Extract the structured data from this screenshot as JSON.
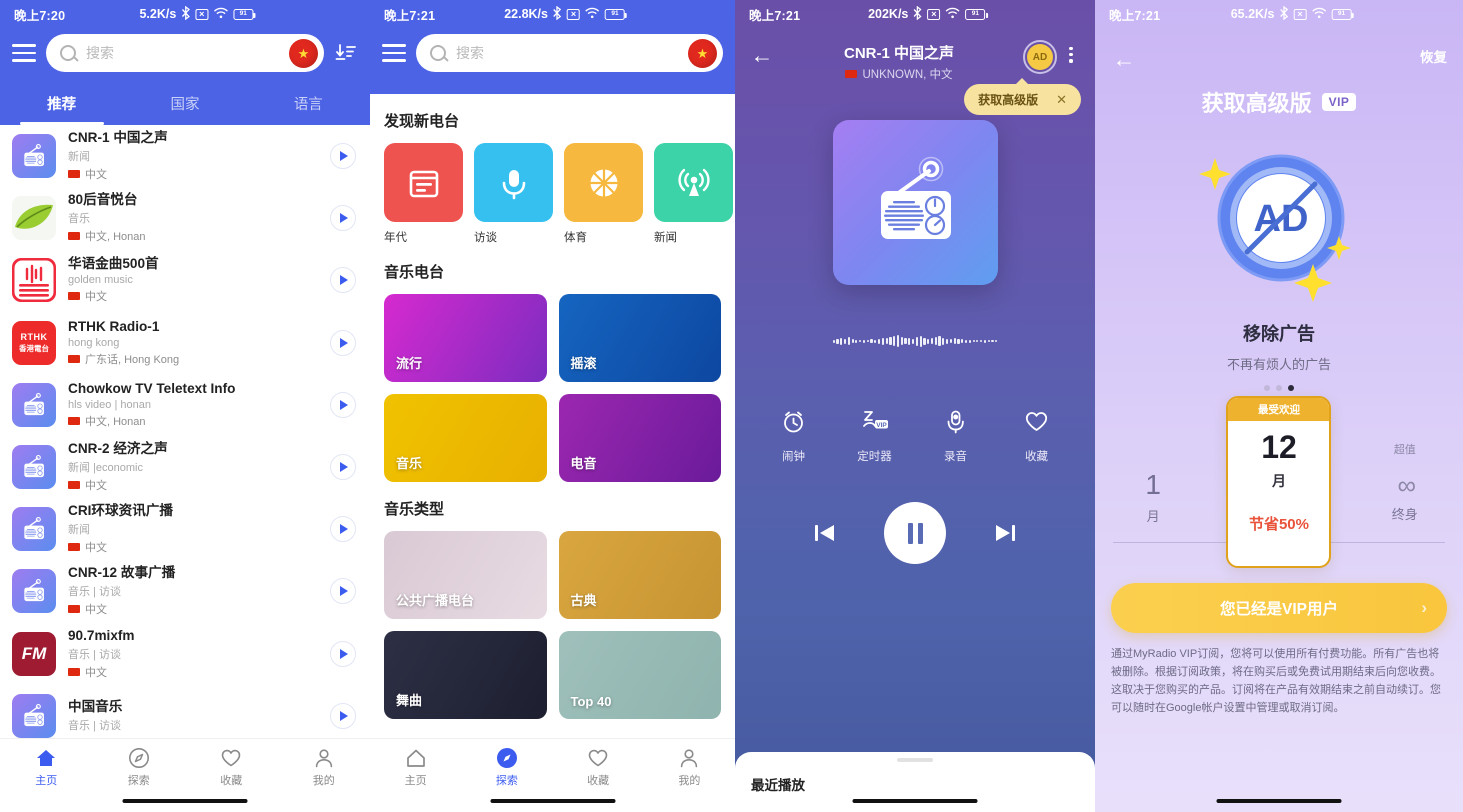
{
  "app": {
    "accent": "#4d63e6",
    "vip_gold": "#f5c944"
  },
  "panel1": {
    "status": {
      "time": "晚上7:20",
      "speed": "5.2K/s",
      "battery": "91"
    },
    "search": {
      "placeholder": "搜索",
      "value": ""
    },
    "menu_icon": "hamburger-icon",
    "flag_icon": "china-flag-icon",
    "sort_icon": "sort-download-icon",
    "tabs": [
      {
        "label": "推荐",
        "active": true
      },
      {
        "label": "国家",
        "active": false
      },
      {
        "label": "语言",
        "active": false
      }
    ],
    "stations": [
      {
        "name": "CNR-1 中国之声",
        "genre": "新闻",
        "lang": "中文",
        "logo": "radio"
      },
      {
        "name": "80后音悦台",
        "genre": "音乐",
        "lang": "中文, Honan",
        "logo": "leaf"
      },
      {
        "name": "华语金曲500首",
        "genre": "golden music",
        "lang": "中文",
        "logo": "redwave"
      },
      {
        "name": "RTHK Radio-1",
        "genre": "hong kong",
        "lang": "广东话, Hong Kong",
        "logo": "rthk"
      },
      {
        "name": "Chowkow TV Teletext Info",
        "genre": "hls video | honan",
        "lang": "中文, Honan",
        "logo": "radio"
      },
      {
        "name": "CNR-2 经济之声",
        "genre": "新闻 |economic",
        "lang": "中文",
        "logo": "radio"
      },
      {
        "name": "CRI环球资讯广播",
        "genre": "新闻",
        "lang": "中文",
        "logo": "radio"
      },
      {
        "name": "CNR-12 故事广播",
        "genre": "音乐 | 访谈",
        "lang": "中文",
        "logo": "radio"
      },
      {
        "name": "90.7mixfm",
        "genre": "音乐 | 访谈",
        "lang": "中文",
        "logo": "fm"
      },
      {
        "name": "中国音乐",
        "genre": "音乐 | 访谈",
        "lang": "",
        "logo": "radio"
      }
    ],
    "nav": [
      {
        "label": "主页",
        "icon": "home-icon",
        "active": true
      },
      {
        "label": "探索",
        "icon": "compass-icon",
        "active": false
      },
      {
        "label": "收藏",
        "icon": "heart-icon",
        "active": false
      },
      {
        "label": "我的",
        "icon": "person-icon",
        "active": false
      }
    ]
  },
  "panel2": {
    "status": {
      "time": "晚上7:21",
      "speed": "22.8K/s",
      "battery": "91"
    },
    "search": {
      "placeholder": "搜索",
      "value": ""
    },
    "sections": [
      {
        "title": "发现新电台"
      },
      {
        "title": "音乐电台"
      },
      {
        "title": "音乐类型"
      }
    ],
    "categories": [
      {
        "label": "年代",
        "color": "#ef5350",
        "icon": "calendar-icon"
      },
      {
        "label": "访谈",
        "color": "#35c0ef",
        "icon": "microphone-icon"
      },
      {
        "label": "体育",
        "color": "#f6b83e",
        "icon": "basketball-icon"
      },
      {
        "label": "新闻",
        "color": "#3cd3a8",
        "icon": "broadcast-icon"
      }
    ],
    "music_stations": [
      {
        "label": "流行",
        "c1": "#d62ad0",
        "c2": "#7b2cbf"
      },
      {
        "label": "摇滚",
        "c1": "#1565c0",
        "c2": "#0d47a1"
      },
      {
        "label": "音乐",
        "c1": "#f0c200",
        "c2": "#e8b000"
      },
      {
        "label": "电音",
        "c1": "#9c27b0",
        "c2": "#6a1b9a"
      }
    ],
    "music_genres": [
      {
        "label": "公共广播电台",
        "c1": "#d9c9d4",
        "c2": "#e8dbe2"
      },
      {
        "label": "古典",
        "c1": "#d9a63f",
        "c2": "#c69432"
      },
      {
        "label": "舞曲",
        "c1": "#2d2f45",
        "c2": "#1d1f30"
      },
      {
        "label": "Top 40",
        "c1": "#9fc0bb",
        "c2": "#8fb3ae"
      }
    ],
    "nav": [
      {
        "label": "主页",
        "icon": "home-icon",
        "active": false
      },
      {
        "label": "探索",
        "icon": "compass-icon",
        "active": true
      },
      {
        "label": "收藏",
        "icon": "heart-icon",
        "active": false
      },
      {
        "label": "我的",
        "icon": "person-icon",
        "active": false
      }
    ]
  },
  "panel3": {
    "status": {
      "time": "晚上7:21",
      "speed": "202K/s",
      "battery": "91"
    },
    "back_icon": "back-arrow-icon",
    "title": "CNR-1 中国之声",
    "subtitle": "UNKNOWN, 中文",
    "ad_badge_label": "AD",
    "more_icon": "more-vertical-icon",
    "tooltip": {
      "text": "获取高级版",
      "close": "✕"
    },
    "artwork_icon": "radio-artwork-icon",
    "actions": [
      {
        "label": "闹钟",
        "icon": "alarm-clock-icon",
        "vip": false
      },
      {
        "label": "定时器",
        "icon": "sleep-timer-icon",
        "vip": true
      },
      {
        "label": "录音",
        "icon": "record-mic-icon",
        "vip": false
      },
      {
        "label": "收藏",
        "icon": "heart-icon",
        "vip": false
      }
    ],
    "transport": {
      "prev_icon": "skip-previous-icon",
      "play_icon": "pause-icon",
      "next_icon": "skip-next-icon",
      "state": "playing"
    },
    "sheet_title": "最近播放"
  },
  "panel4": {
    "status": {
      "time": "晚上7:21",
      "speed": "65.2K/s",
      "battery": "91"
    },
    "back_icon": "back-arrow-icon",
    "restore_label": "恢复",
    "title": "获取高级版",
    "vip_chip": "VIP",
    "hero_icon": "no-ads-icon",
    "hero_badge_text": "AD",
    "heading": "移除广告",
    "subheading": "不再有烦人的广告",
    "pager": {
      "total": 3,
      "active": 3
    },
    "plans": [
      {
        "top": "",
        "num": "1",
        "unit": "月",
        "save": "",
        "featured": false
      },
      {
        "top": "最受欢迎",
        "num": "12",
        "unit": "月",
        "save": "节省50%",
        "featured": true
      },
      {
        "top": "超值",
        "num": "∞",
        "unit": "终身",
        "save": "",
        "featured": false
      }
    ],
    "cta": {
      "label": "您已经是VIP用户",
      "chevron": "›"
    },
    "legal": "通过MyRadio VIP订阅，您将可以使用所有付费功能。所有广告也将被删除。根据订阅政策，将在购买后或免费试用期结束后向您收费。这取决于您购买的产品。订阅将在产品有效期结束之前自动续订。您可以随时在Google帐户设置中管理或取消订阅。"
  }
}
